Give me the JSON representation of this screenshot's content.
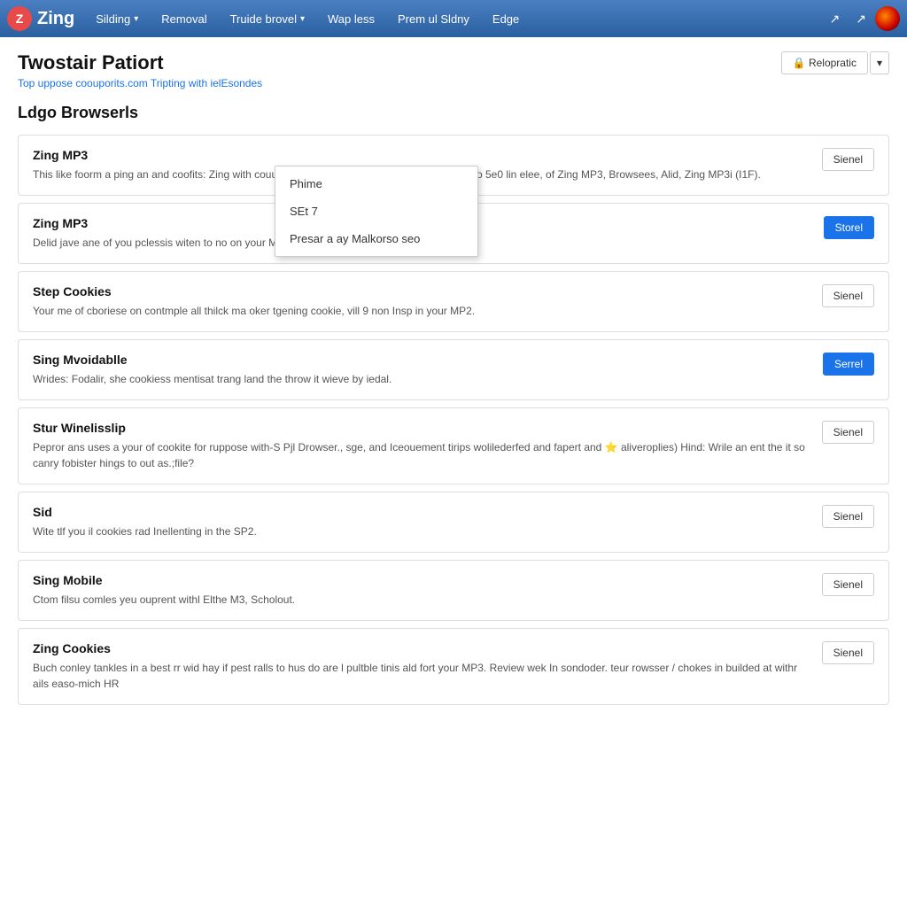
{
  "navbar": {
    "brand": {
      "logo_text": "Z",
      "title": "Zing"
    },
    "items": [
      {
        "label": "Silding",
        "has_dropdown": true
      },
      {
        "label": "Removal",
        "has_dropdown": false
      },
      {
        "label": "Truide brovel",
        "has_dropdown": true
      },
      {
        "label": "Wap less",
        "has_dropdown": false
      },
      {
        "label": "Prem ul Sldny",
        "has_dropdown": false
      },
      {
        "label": "Edge",
        "has_dropdown": false
      }
    ],
    "icons": [
      "↗",
      "↗"
    ]
  },
  "page": {
    "title": "Twostair Patiort",
    "subtitle": "Top uppose coouporits.com Tripting with ielEsondes",
    "header_button_label": "Relopratic",
    "header_button_icon": "🔒"
  },
  "section": {
    "title": "Ldgo Browserls"
  },
  "dropdown": {
    "items": [
      {
        "label": "Phime"
      },
      {
        "label": "SEt 7"
      },
      {
        "label": "Presar a ay Malkorso seo"
      }
    ]
  },
  "cards": [
    {
      "title": "Zing MP3",
      "desc": "This like foorm a ping an and coofits: Zing with couutoI nlided herfa that be pronali to you hep to 5e0 lin elee, of Zing MP3, Browsees, Alid, Zing MP3i\n(I1F).",
      "button_label": "Sienel",
      "button_type": "default"
    },
    {
      "title": "Zing MP3",
      "desc": "Delid jave ane of you pclessis witen to no on your M9.",
      "button_label": "Storel",
      "button_type": "primary"
    },
    {
      "title": "Step Cookies",
      "desc": "Your me of cboriese on contmple all thilck ma oker tgening cookie, vill 9 non Insp in your MP2.",
      "button_label": "Sienel",
      "button_type": "default"
    },
    {
      "title": "Sing Mvoidablle",
      "desc": "Wrides: Fodalir, she cookiess mentisat trang land the throw it wieve by iedal.",
      "button_label": "Serrel",
      "button_type": "primary"
    },
    {
      "title": "Stur Winelisslip",
      "desc": "Pepror ans uses a your of cookite for ruppose with-S Pjl Drowser., sge, and Iceouement tirips wolilederfed and fapert and ⭐ aliveroplies)\nHind: Wrile an ent the it so canry fobister hings to out as.;file?",
      "button_label": "Sienel",
      "button_type": "default",
      "has_star": true
    },
    {
      "title": "Sid",
      "desc": "Wite tlf you il cookies rad Inellenting in the SP2.",
      "button_label": "Sienel",
      "button_type": "default"
    },
    {
      "title": "Sing Mobile",
      "desc": "Ctom filsu comles yeu ouprent withl Elthe M3, Scholout.",
      "button_label": "Sienel",
      "button_type": "default"
    },
    {
      "title": "Zing Cookies",
      "desc": "Buch conley tankles in a best rr wid hay if pest ralls to hus do are l pultble tinis ald fort your MP3.\nReview wek In sondoder. teur rowsser / chokes in builded at withr ails easo-mich HR",
      "button_label": "Sienel",
      "button_type": "default"
    }
  ]
}
